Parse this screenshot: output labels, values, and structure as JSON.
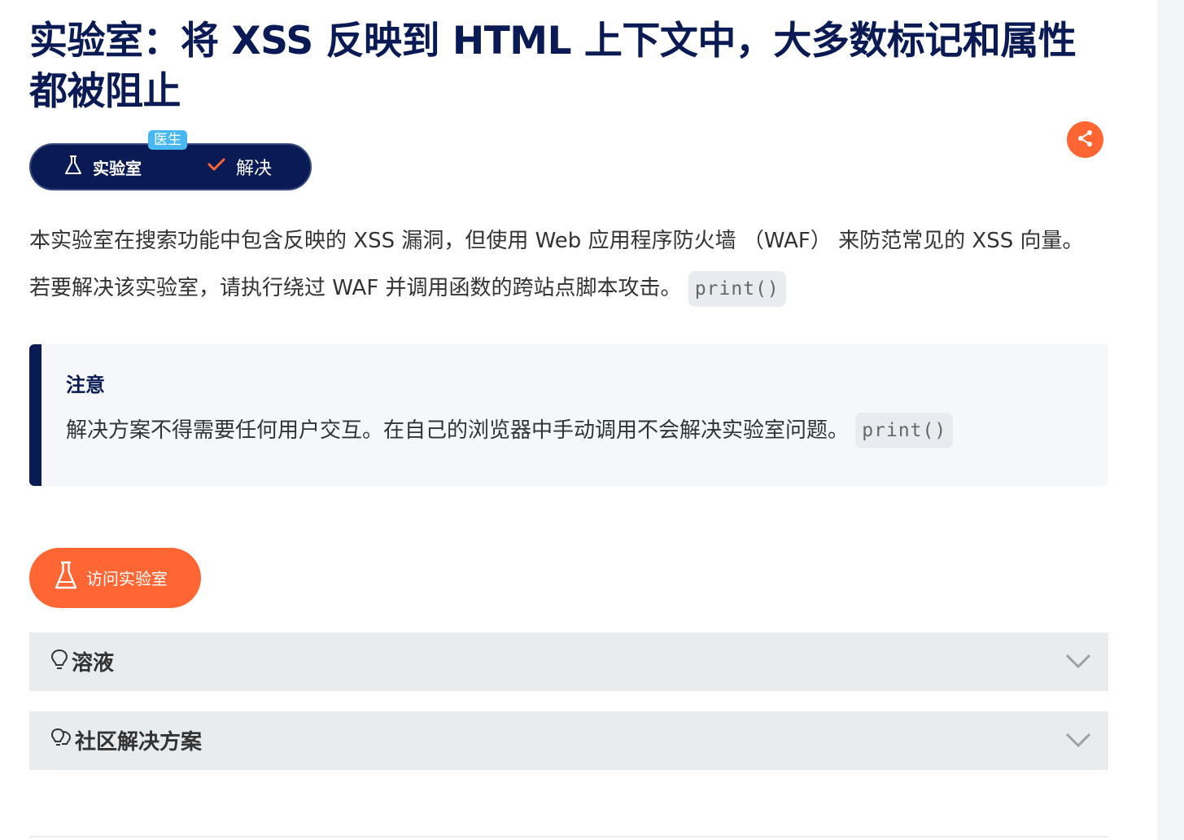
{
  "title": "实验室：将 XSS 反映到 HTML 上下文中，大多数标记和属性都被阻止",
  "level_badge": "医生",
  "status_pill": {
    "lab_label": "实验室",
    "solved_label": "解决"
  },
  "share_icon": "share-icon",
  "description": {
    "paragraph_1": "本实验室在搜索功能中包含反映的 XSS 漏洞，但使用 Web 应用程序防火墙 （WAF） 来防范常见的 XSS 向量。",
    "paragraph_2_text": "若要解决该实验室，请执行绕过 WAF 并调用函数的跨站点脚本攻击。",
    "paragraph_2_code": "print()"
  },
  "note": {
    "heading": "注意",
    "text": "解决方案不得需要任何用户交互。在自己的浏览器中手动调用不会解决实验室问题。",
    "code": "print()"
  },
  "access_button": {
    "label": "访问实验室",
    "icon": "flask-icon"
  },
  "accordions": [
    {
      "label": "溶液",
      "icon": "lightbulb-icon"
    },
    {
      "label": "社区解决方案",
      "icon": "lightbulbs-icon"
    }
  ],
  "colors": {
    "navy": "#0a1a54",
    "orange": "#ff6633",
    "badge_blue": "#49b8f0",
    "panel_grey": "#e8ecef",
    "note_bg": "#f5f7fa"
  }
}
